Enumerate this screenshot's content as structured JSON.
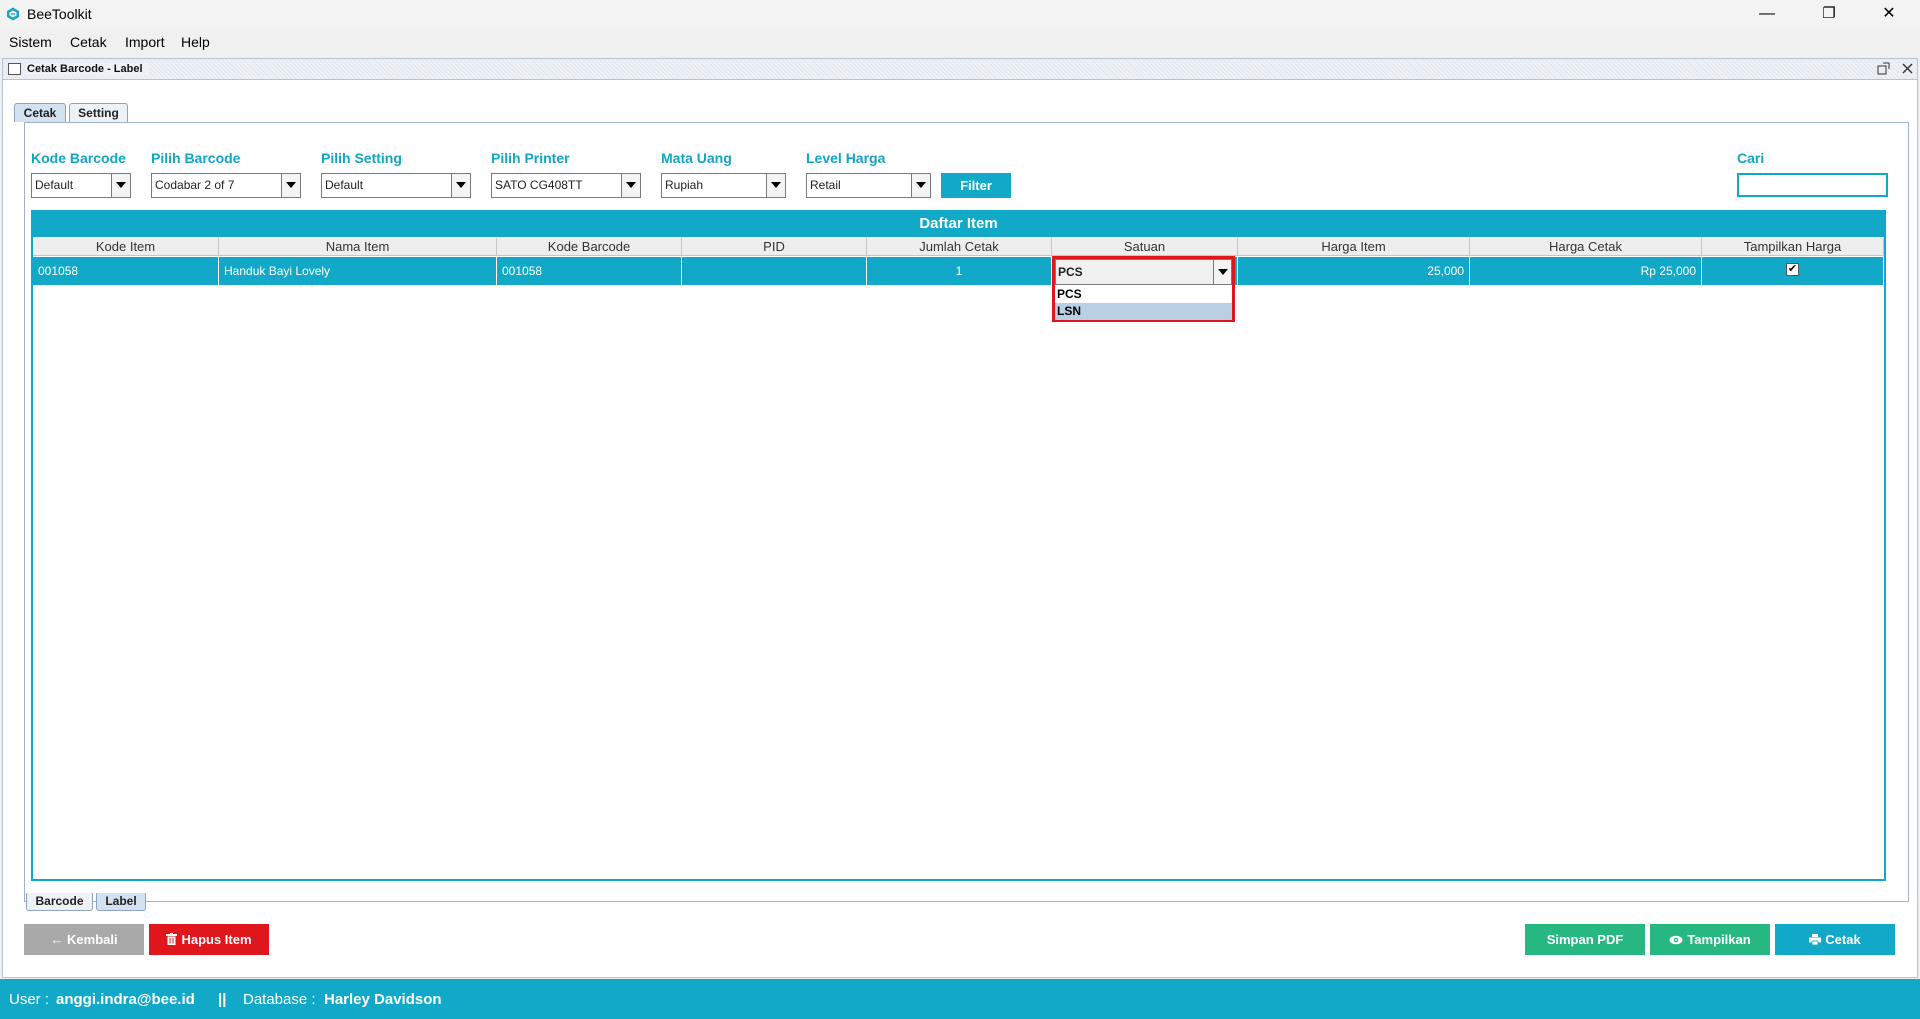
{
  "app": {
    "title": "BeeToolkit"
  },
  "window_controls": {
    "minimize": "—",
    "maximize": "❐",
    "close": "✕"
  },
  "menu": [
    "Sistem",
    "Cetak",
    "Import",
    "Help"
  ],
  "internal_frame": {
    "title": "Cetak Barcode - Label"
  },
  "top_tabs": [
    {
      "label": "Cetak",
      "active": true
    },
    {
      "label": "Setting",
      "active": false
    }
  ],
  "filters": {
    "kode_barcode": {
      "label": "Kode Barcode",
      "value": "Default"
    },
    "pilih_barcode": {
      "label": "Pilih Barcode",
      "value": "Codabar 2 of 7"
    },
    "pilih_setting": {
      "label": "Pilih Setting",
      "value": "Default"
    },
    "pilih_printer": {
      "label": "Pilih Printer",
      "value": "SATO CG408TT"
    },
    "mata_uang": {
      "label": "Mata Uang",
      "value": "Rupiah"
    },
    "level_harga": {
      "label": "Level Harga",
      "value": "Retail"
    },
    "filter_button": "Filter",
    "cari": {
      "label": "Cari",
      "value": ""
    }
  },
  "grid": {
    "title": "Daftar Item",
    "columns": [
      "Kode Item",
      "Nama Item",
      "Kode Barcode",
      "PID",
      "Jumlah Cetak",
      "Satuan",
      "Harga Item",
      "Harga Cetak",
      "Tampilkan Harga"
    ],
    "rows": [
      {
        "kode_item": "001058",
        "nama_item": "Handuk Bayi Lovely",
        "kode_barcode": "001058",
        "pid": "",
        "jumlah_cetak": "1",
        "satuan": "PCS",
        "harga_item": "25,000",
        "harga_cetak": "Rp 25,000",
        "tampilkan_harga": true
      }
    ],
    "satuan_options": [
      "PCS",
      "LSN"
    ],
    "satuan_highlighted": "LSN"
  },
  "bottom_tabs": [
    {
      "label": "Barcode",
      "active": false
    },
    {
      "label": "Label",
      "active": true
    }
  ],
  "buttons": {
    "kembali": "Kembali",
    "hapus_item": "Hapus Item",
    "simpan_pdf": "Simpan PDF",
    "tampilkan": "Tampilkan",
    "cetak": "Cetak"
  },
  "status": {
    "user_label": "User :",
    "user": "anggi.indra@bee.id",
    "separator": "||",
    "database_label": "Database :",
    "database": "Harley Davidson"
  },
  "colors": {
    "accent": "#11a9c7",
    "danger": "#e0161d",
    "success": "#27b882",
    "disabled": "#a9a9a9"
  }
}
